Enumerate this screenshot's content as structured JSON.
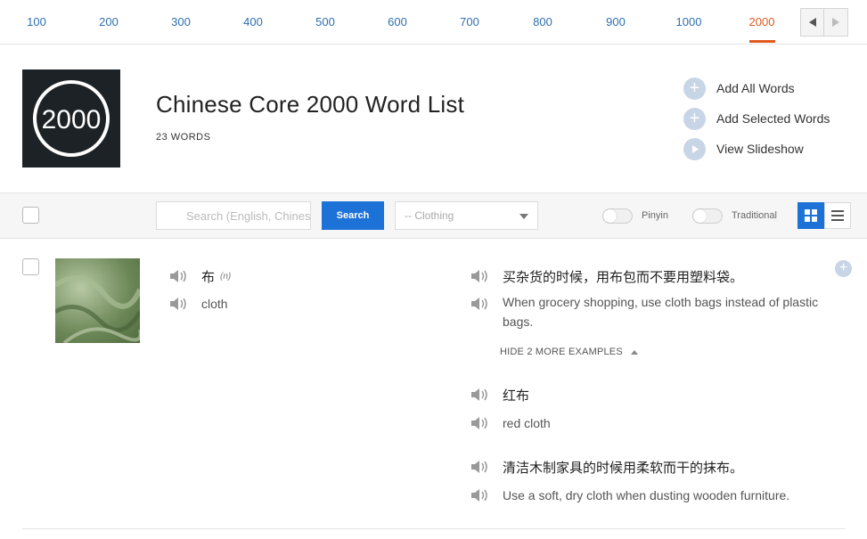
{
  "levels": {
    "tabs": [
      "100",
      "200",
      "300",
      "400",
      "500",
      "600",
      "700",
      "800",
      "900",
      "1000",
      "2000"
    ],
    "active": "2000",
    "accent_color": "#e05a1e",
    "prev_icon": "triangle-left-icon",
    "next_icon": "triangle-right-icon"
  },
  "header": {
    "logo_text": "2000",
    "title": "Chinese Core 2000 Word List",
    "word_count": "23 WORDS",
    "actions": [
      {
        "label": "Add All Words",
        "icon": "plus-circle-icon"
      },
      {
        "label": "Add Selected Words",
        "icon": "plus-circle-icon"
      },
      {
        "label": "View Slideshow",
        "icon": "play-circle-icon"
      }
    ]
  },
  "toolbar": {
    "search_placeholder": "Search (English, Chinese)",
    "search_button": "Search",
    "category_select": "-- Clothing",
    "toggle_pinyin": "Pinyin",
    "toggle_traditional": "Traditional",
    "view_grid_active": true,
    "primary_color": "#1c72d6"
  },
  "entry": {
    "word": "布",
    "part_of_speech": "(n)",
    "meaning": "cloth",
    "examples": [
      {
        "zh": "买杂货的时候，用布包而不要用塑料袋。",
        "en_line1": "When grocery shopping, use cloth bags instead of plastic",
        "en_line2": "bags."
      },
      {
        "zh": "红布",
        "en_line1": "red cloth"
      },
      {
        "zh": "清洁木制家具的时候用柔软而干的抹布。",
        "en_line1": "Use a soft, dry cloth when dusting wooden furniture."
      }
    ],
    "toggle_examples": "HIDE 2 MORE EXAMPLES"
  }
}
